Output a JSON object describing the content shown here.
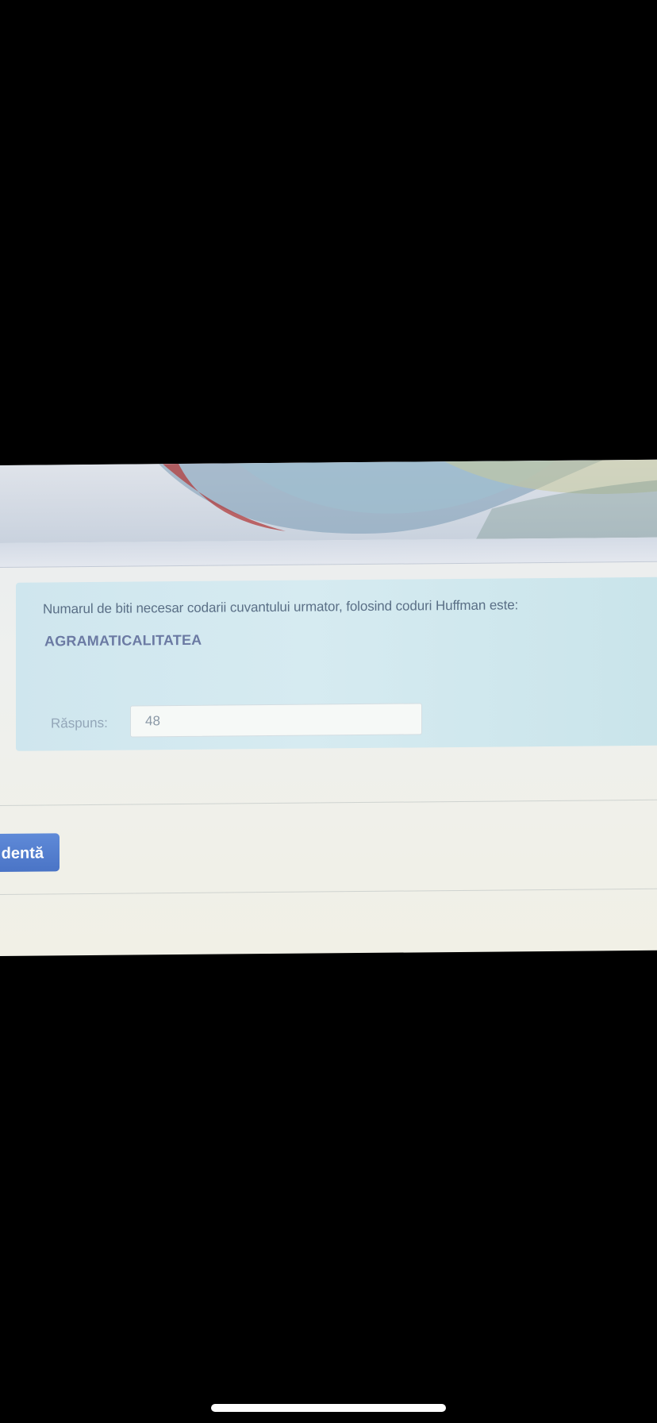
{
  "question": {
    "prompt": "Numarul de biti necesar codarii cuvantului urmator, folosind coduri Huffman este:",
    "word": "AGRAMATICALITATEA"
  },
  "answer": {
    "label": "Răspuns:",
    "value": "48"
  },
  "navigation": {
    "previous_label": "dentă"
  },
  "colors": {
    "question_box": "#cfe6ee",
    "button": "#4a74c6",
    "word": "#6b7aa3"
  }
}
